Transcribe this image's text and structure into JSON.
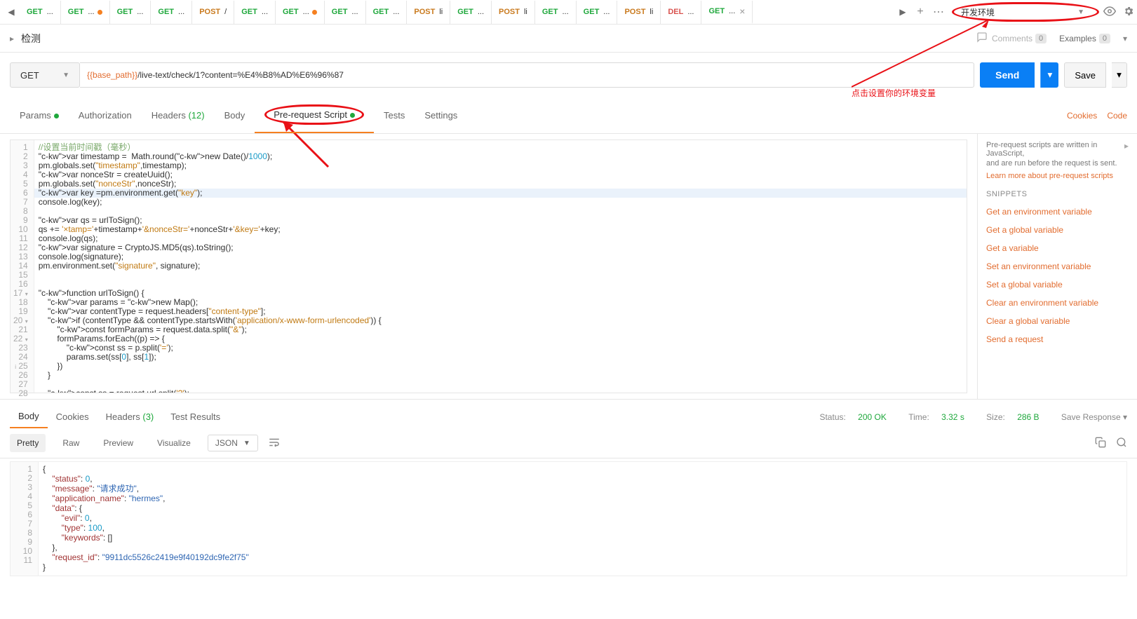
{
  "tabs": [
    {
      "m": "GET",
      "cls": "m-GET",
      "lbl": "...",
      "dot": false
    },
    {
      "m": "GET",
      "cls": "m-GET",
      "lbl": "...",
      "dot": true
    },
    {
      "m": "GET",
      "cls": "m-GET",
      "lbl": "...",
      "dot": false
    },
    {
      "m": "GET",
      "cls": "m-GET",
      "lbl": "...",
      "dot": false
    },
    {
      "m": "POST",
      "cls": "m-POST",
      "lbl": "/",
      "dot": false
    },
    {
      "m": "GET",
      "cls": "m-GET",
      "lbl": "...",
      "dot": false
    },
    {
      "m": "GET",
      "cls": "m-GET",
      "lbl": "...",
      "dot": true
    },
    {
      "m": "GET",
      "cls": "m-GET",
      "lbl": "...",
      "dot": false
    },
    {
      "m": "GET",
      "cls": "m-GET",
      "lbl": "...",
      "dot": false
    },
    {
      "m": "POST",
      "cls": "m-POST",
      "lbl": "li",
      "dot": false
    },
    {
      "m": "GET",
      "cls": "m-GET",
      "lbl": "...",
      "dot": false
    },
    {
      "m": "POST",
      "cls": "m-POST",
      "lbl": "li",
      "dot": false
    },
    {
      "m": "GET",
      "cls": "m-GET",
      "lbl": "...",
      "dot": false
    },
    {
      "m": "GET",
      "cls": "m-GET",
      "lbl": "...",
      "dot": false
    },
    {
      "m": "POST",
      "cls": "m-POST",
      "lbl": "li",
      "dot": false
    },
    {
      "m": "DEL",
      "cls": "m-DEL",
      "lbl": "...",
      "dot": false
    },
    {
      "m": "GET",
      "cls": "m-GET",
      "lbl": "...",
      "dot": false,
      "active": true,
      "close": true
    }
  ],
  "env": {
    "name": "开发环境"
  },
  "anno": {
    "text": "点击设置你的环境变量"
  },
  "breadcrumb": {
    "name": "检测"
  },
  "comments": {
    "label": "Comments",
    "count": "0"
  },
  "examples": {
    "label": "Examples",
    "count": "0"
  },
  "request": {
    "method": "GET",
    "url_var": "{{base_path}}",
    "url_rest": "/live-text/check/1?content=%E4%B8%AD%E6%96%87",
    "send": "Send",
    "save": "Save"
  },
  "reqtabs": {
    "params": "Params",
    "auth": "Authorization",
    "headers": "Headers",
    "headers_ct": "(12)",
    "body": "Body",
    "prs": "Pre-request Script",
    "tests": "Tests",
    "settings": "Settings",
    "cookies": "Cookies",
    "code": "Code"
  },
  "prescript_lines": [
    {
      "n": "1",
      "t": "//设置当前时间戳（毫秒）",
      "cls": "c-cmt"
    },
    {
      "n": "2",
      "t": "var timestamp =  Math.round(new Date()/1000);"
    },
    {
      "n": "3",
      "t": "pm.globals.set(\"timestamp\",timestamp);"
    },
    {
      "n": "4",
      "t": "var nonceStr = createUuid();"
    },
    {
      "n": "5",
      "t": "pm.globals.set(\"nonceStr\",nonceStr);"
    },
    {
      "n": "6",
      "t": "var key =pm.environment.get(\"key\"); ",
      "hl": true
    },
    {
      "n": "7",
      "t": "console.log(key);"
    },
    {
      "n": "8",
      "t": ""
    },
    {
      "n": "9",
      "t": "var qs = urlToSign();"
    },
    {
      "n": "10",
      "t": "qs += '&timestamp='+timestamp+'&nonceStr='+nonceStr+'&key='+key;"
    },
    {
      "n": "11",
      "t": "console.log(qs);"
    },
    {
      "n": "12",
      "t": "var signature = CryptoJS.MD5(qs).toString();"
    },
    {
      "n": "13",
      "t": "console.log(signature);"
    },
    {
      "n": "14",
      "t": "pm.environment.set(\"signature\", signature);"
    },
    {
      "n": "15",
      "t": ""
    },
    {
      "n": "16",
      "t": ""
    },
    {
      "n": "17",
      "t": "function urlToSign() {",
      "fold": true
    },
    {
      "n": "18",
      "t": "    var params = new Map();"
    },
    {
      "n": "19",
      "t": "    var contentType = request.headers[\"content-type\"];"
    },
    {
      "n": "20",
      "t": "    if (contentType && contentType.startsWith('application/x-www-form-urlencoded')) {",
      "fold": true
    },
    {
      "n": "21",
      "t": "        const formParams = request.data.split(\"&\");"
    },
    {
      "n": "22",
      "t": "        formParams.forEach((p) => {",
      "fold": true
    },
    {
      "n": "23",
      "t": "            const ss = p.split('=');"
    },
    {
      "n": "24",
      "t": "            params.set(ss[0], ss[1]);"
    },
    {
      "n": "25",
      "t": "        })",
      "info": true
    },
    {
      "n": "26",
      "t": "    }"
    },
    {
      "n": "27",
      "t": ""
    },
    {
      "n": "28",
      "t": "    const ss = request.url.split('?');"
    }
  ],
  "side": {
    "desc1": "Pre-request scripts are written in JavaScript,",
    "desc2": "and are run before the request is sent.",
    "learn": "Learn more about pre-request scripts",
    "snip_hd": "SNIPPETS",
    "snips": [
      "Get an environment variable",
      "Get a global variable",
      "Get a variable",
      "Set an environment variable",
      "Set a global variable",
      "Clear an environment variable",
      "Clear a global variable",
      "Send a request"
    ]
  },
  "resp": {
    "tabs": {
      "body": "Body",
      "cookies": "Cookies",
      "headers": "Headers",
      "headers_ct": "(3)",
      "tests": "Test Results"
    },
    "status_lbl": "Status:",
    "status_v": "200 OK",
    "time_lbl": "Time:",
    "time_v": "3.32 s",
    "size_lbl": "Size:",
    "size_v": "286 B",
    "save": "Save Response",
    "sub": {
      "pretty": "Pretty",
      "raw": "Raw",
      "preview": "Preview",
      "visualize": "Visualize",
      "fmt": "JSON"
    }
  },
  "resp_lines": [
    {
      "n": "1",
      "t": "{"
    },
    {
      "n": "2",
      "t": "    \"status\": 0,"
    },
    {
      "n": "3",
      "t": "    \"message\": \"请求成功\","
    },
    {
      "n": "4",
      "t": "    \"application_name\": \"hermes\","
    },
    {
      "n": "5",
      "t": "    \"data\": {"
    },
    {
      "n": "6",
      "t": "        \"evil\": 0,"
    },
    {
      "n": "7",
      "t": "        \"type\": 100,"
    },
    {
      "n": "8",
      "t": "        \"keywords\": []"
    },
    {
      "n": "9",
      "t": "    },"
    },
    {
      "n": "10",
      "t": "    \"request_id\": \"9911dc5526c2419e9f40192dc9fe2f75\""
    },
    {
      "n": "11",
      "t": "}"
    }
  ]
}
